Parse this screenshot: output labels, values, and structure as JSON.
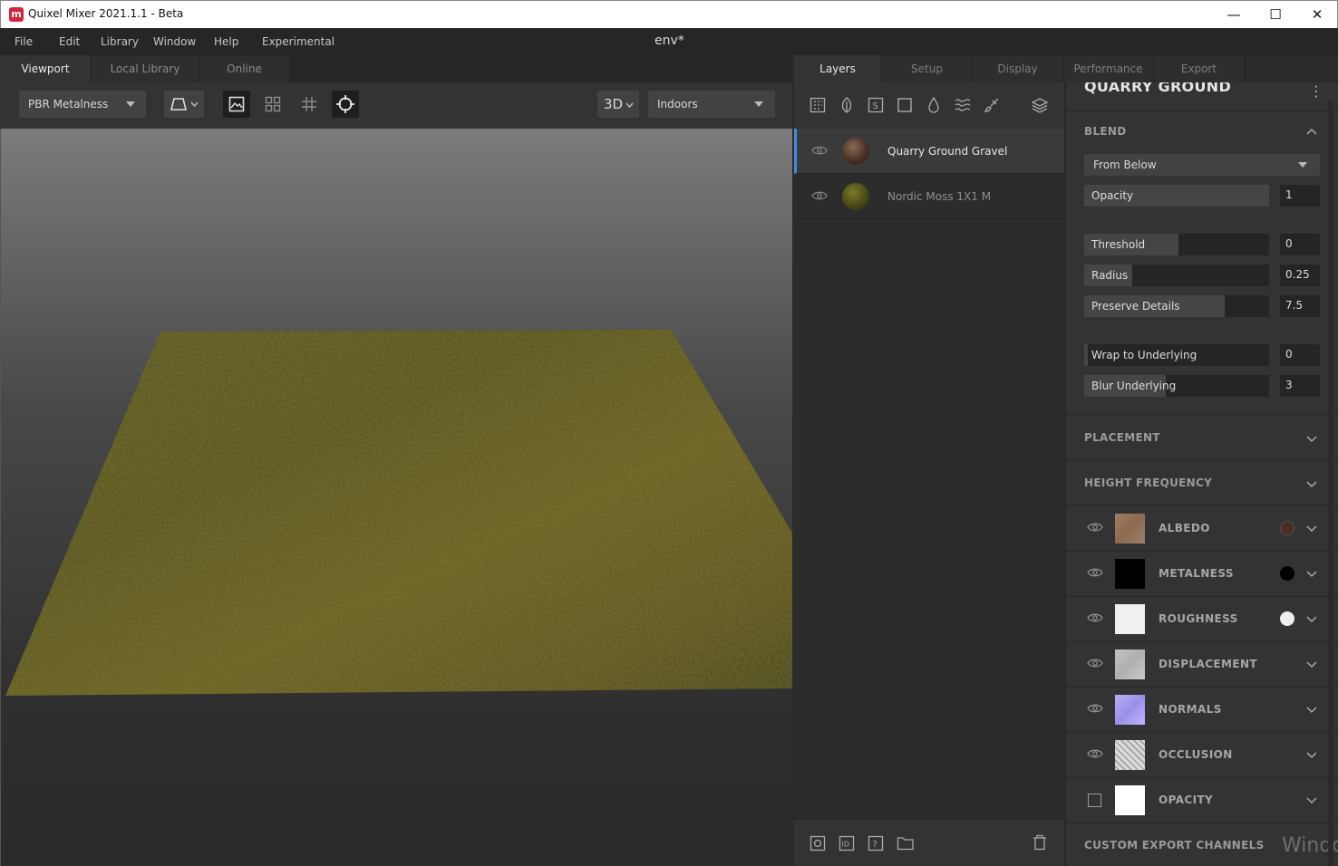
{
  "window": {
    "title": "Quixel Mixer 2021.1.1 - Beta",
    "logo_letter": "m",
    "minimize": "—",
    "maximize": "☐",
    "close": "✕"
  },
  "menu": {
    "items": [
      "File",
      "Edit",
      "Library",
      "Window",
      "Help",
      "Experimental"
    ],
    "document": "env*"
  },
  "viewport_tabs": [
    "Viewport",
    "Local Library",
    "Online"
  ],
  "toolbar": {
    "shading_mode": "PBR Metalness",
    "view_mode": "3D",
    "environment": "Indoors"
  },
  "layer_tabs": [
    "Layers",
    "Setup",
    "Display",
    "Performance",
    "Export"
  ],
  "layers": [
    {
      "name": "Quarry Ground Gravel",
      "selected": true
    },
    {
      "name": "Nordic Moss 1X1 M",
      "selected": false
    }
  ],
  "properties": {
    "title": "QUARRY GROUND",
    "blend": {
      "section": "BLEND",
      "mode": "From Below",
      "opacity": {
        "label": "Opacity",
        "value": "1",
        "fill": 1.0
      },
      "threshold": {
        "label": "Threshold",
        "value": "0",
        "fill": 0.51
      },
      "radius": {
        "label": "Radius",
        "value": "0.25",
        "fill": 0.26
      },
      "preserve_details": {
        "label": "Preserve Details",
        "value": "7.5",
        "fill": 0.76
      },
      "wrap_to_underlying": {
        "label": "Wrap to Underlying",
        "value": "0",
        "fill": 0.02
      },
      "blur_underlying": {
        "label": "Blur Underlying",
        "value": "3",
        "fill": 0.44
      }
    },
    "placement": "PLACEMENT",
    "height_frequency": "HEIGHT FREQUENCY",
    "channels": [
      {
        "name": "ALBEDO",
        "dot": "#4a2c22"
      },
      {
        "name": "METALNESS",
        "dot": "#000000"
      },
      {
        "name": "ROUGHNESS",
        "dot": "#eeeeee"
      },
      {
        "name": "DISPLACEMENT"
      },
      {
        "name": "NORMALS"
      },
      {
        "name": "OCCLUSION"
      },
      {
        "name": "OPACITY"
      }
    ],
    "custom_export": "CUSTOM EXPORT CHANNELS"
  },
  "watermark": "Windo"
}
